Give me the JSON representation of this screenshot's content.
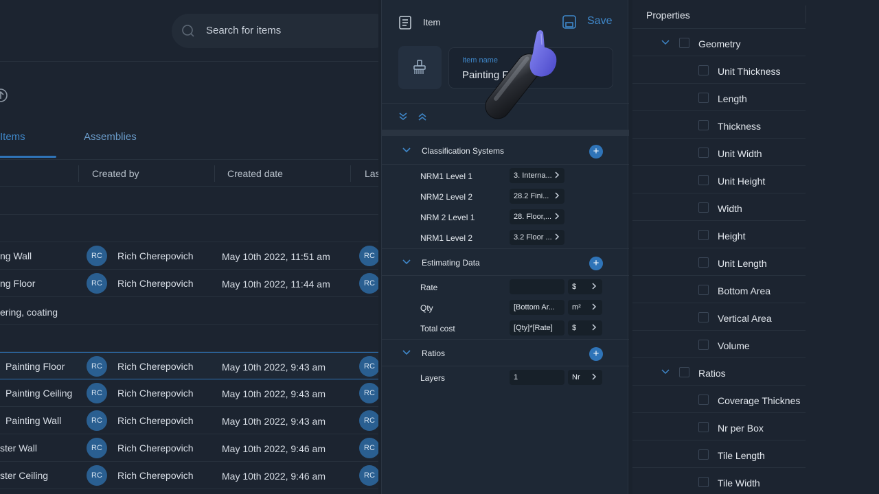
{
  "search": {
    "placeholder": "Search for items"
  },
  "tabs": {
    "items": "Items",
    "assemblies": "Assemblies"
  },
  "columns": {
    "created_by": "Created by",
    "created_date": "Created date",
    "last": "Las"
  },
  "rows": [
    {
      "name": "ng Wall",
      "avatar": "RC",
      "created_by": "Rich Cherepovich",
      "date": "May 10th 2022, 11:51 am"
    },
    {
      "name": "ng Floor",
      "avatar": "RC",
      "created_by": "Rich Cherepovich",
      "date": "May 10th 2022, 11:44 am"
    }
  ],
  "group_label": "ering, coating",
  "rows2": [
    {
      "name": "Painting Floor",
      "avatar": "RC",
      "created_by": "Rich Cherepovich",
      "date": "May 10th 2022, 9:43 am"
    },
    {
      "name": "Painting Ceiling",
      "avatar": "RC",
      "created_by": "Rich Cherepovich",
      "date": "May 10th 2022, 9:43 am"
    },
    {
      "name": "Painting Wall",
      "avatar": "RC",
      "created_by": "Rich Cherepovich",
      "date": "May 10th 2022, 9:43 am"
    },
    {
      "name": "ster Wall",
      "avatar": "RC",
      "created_by": "Rich Cherepovich",
      "date": "May 10th 2022, 9:46 am"
    },
    {
      "name": "ster Ceiling",
      "avatar": "RC",
      "created_by": "Rich Cherepovich",
      "date": "May 10th 2022, 9:46 am"
    }
  ],
  "editor": {
    "header": "Item",
    "save": "Save",
    "name_label": "Item name",
    "name_value": "Painting F",
    "sections": {
      "classification": "Classification Systems",
      "estimating": "Estimating Data",
      "ratios": "Ratios"
    },
    "classification_fields": [
      {
        "label": "NRM1 Level 1",
        "value": "3. Interna..."
      },
      {
        "label": "NRM2 Level 2",
        "value": "28.2 Fini..."
      },
      {
        "label": "NRM 2 Level 1",
        "value": "28. Floor,..."
      },
      {
        "label": "NRM1 Level 2",
        "value": "3.2 Floor ..."
      }
    ],
    "estimating_fields": [
      {
        "label": "Rate",
        "value": "",
        "unit": "$"
      },
      {
        "label": "Qty",
        "value": "[Bottom Ar...",
        "unit": "m²"
      },
      {
        "label": "Total cost",
        "value": "[Qty]*[Rate]",
        "unit": "$"
      }
    ],
    "ratio_fields": [
      {
        "label": "Layers",
        "value": "1",
        "unit": "Nr"
      }
    ]
  },
  "properties": {
    "header": "Properties",
    "geometry_group": "Geometry",
    "geometry": [
      "Unit Thickness",
      "Length",
      "Thickness",
      "Unit Width",
      "Unit Height",
      "Width",
      "Height",
      "Unit Length",
      "Bottom Area",
      "Vertical Area",
      "Volume"
    ],
    "ratios_group": "Ratios",
    "ratios": [
      "Coverage Thicknes",
      "Nr per Box",
      "Tile Length",
      "Tile Width"
    ]
  },
  "colors": {
    "accent": "#2f74b8",
    "link": "#3f87c9",
    "avatar": "#2a5f91",
    "bg": "#1c2430"
  }
}
